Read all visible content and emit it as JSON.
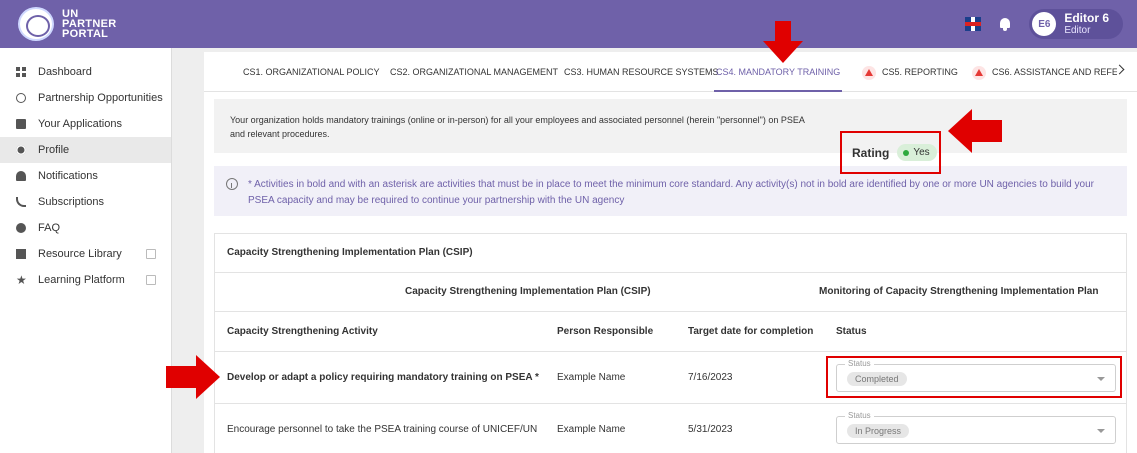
{
  "header": {
    "logo_lines": [
      "UN",
      "PARTNER",
      "PORTAL"
    ],
    "user": {
      "initials": "E6",
      "name": "Editor 6",
      "role": "Editor"
    }
  },
  "sidebar": {
    "items": [
      {
        "label": "Dashboard",
        "icon": "dashboard-icon"
      },
      {
        "label": "Partnership Opportunities",
        "icon": "globe-icon"
      },
      {
        "label": "Your Applications",
        "icon": "applications-icon"
      },
      {
        "label": "Profile",
        "icon": "gear-icon"
      },
      {
        "label": "Notifications",
        "icon": "bell-icon"
      },
      {
        "label": "Subscriptions",
        "icon": "rss-icon"
      },
      {
        "label": "FAQ",
        "icon": "help-icon"
      },
      {
        "label": "Resource Library",
        "icon": "book-icon"
      },
      {
        "label": "Learning Platform",
        "icon": "star-icon"
      }
    ]
  },
  "tabs": [
    {
      "label": "CS1. ORGANIZATIONAL POLICY"
    },
    {
      "label": "CS2. ORGANIZATIONAL MANAGEMENT"
    },
    {
      "label": "CS3. HUMAN RESOURCE SYSTEMS"
    },
    {
      "label": "CS4. MANDATORY TRAINING",
      "active": true
    },
    {
      "label": "CS5. REPORTING",
      "warning": true
    },
    {
      "label": "CS6. ASSISTANCE AND REFE",
      "warning": true
    }
  ],
  "standard": {
    "description": "Your organization holds mandatory trainings (online or in-person) for all your employees and associated personnel (herein \"personnel\") on PSEA and relevant procedures.",
    "rating_label": "Rating",
    "rating_value": "Yes"
  },
  "info_note": "* Activities in bold and with an asterisk are activities that must be in place to meet the minimum core standard. Any activity(s) not in bold are identified by one or more UN agencies to build your PSEA capacity and may be required to continue your partnership with the UN agency",
  "csip": {
    "title": "Capacity Strengthening Implementation Plan (CSIP)",
    "group_headers": {
      "plan": "Capacity Strengthening Implementation Plan (CSIP)",
      "monitoring": "Monitoring of Capacity Strengthening Implementation Plan"
    },
    "columns": {
      "activity": "Capacity Strengthening Activity",
      "person": "Person Responsible",
      "target": "Target date for completion",
      "status": "Status"
    },
    "status_field_label": "Status",
    "rows": [
      {
        "activity": "Develop or adapt a policy requiring mandatory training on PSEA *",
        "person": "Example Name",
        "target": "7/16/2023",
        "status": "Completed",
        "core": true
      },
      {
        "activity": "Encourage personnel to take the PSEA training course of UNICEF/UN",
        "person": "Example Name",
        "target": "5/31/2023",
        "status": "In Progress",
        "core": false
      }
    ]
  },
  "colors": {
    "header_bg": "#6f61a9",
    "accent": "#6f61a9",
    "annotation_red": "#e00000",
    "yes_dot": "#2eaa3e"
  }
}
